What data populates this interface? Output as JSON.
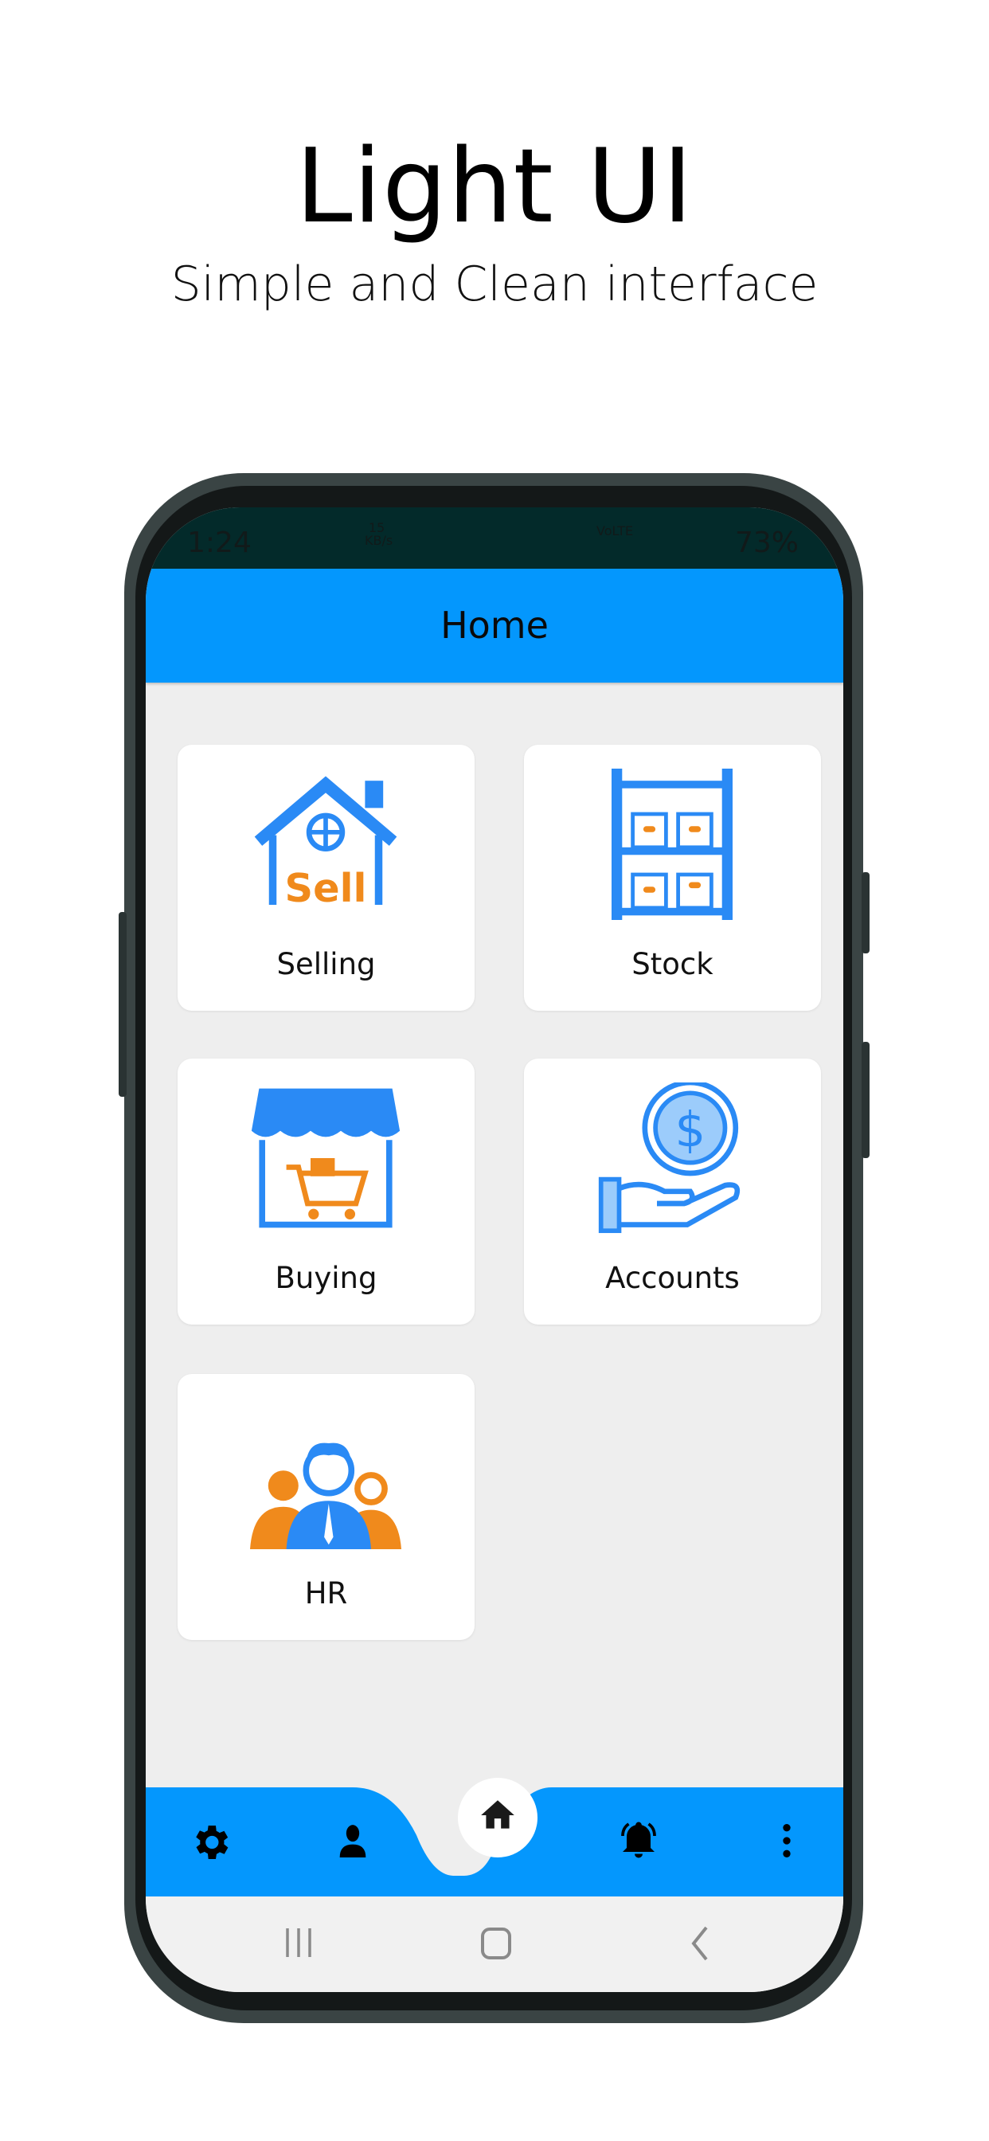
{
  "promo": {
    "title": "Light UI",
    "subtitle": "Simple and Clean interface"
  },
  "status_bar": {
    "time": "1:24",
    "net_speed": "15 KB/s",
    "battery": "73%",
    "network": "VoLTE"
  },
  "header": {
    "title": "Home"
  },
  "menu": [
    {
      "label": "Selling",
      "icon": "sell-house-icon",
      "badge_text": "Sell"
    },
    {
      "label": "Stock",
      "icon": "warehouse-shelf-icon"
    },
    {
      "label": "Buying",
      "icon": "shop-cart-icon"
    },
    {
      "label": "Accounts",
      "icon": "hand-dollar-coin-icon"
    },
    {
      "label": "HR",
      "icon": "people-group-icon"
    }
  ],
  "bottom_nav": {
    "items": [
      "settings-icon",
      "profile-icon",
      "home-icon",
      "notifications-icon",
      "more-icon"
    ],
    "active": "home-icon"
  },
  "colors": {
    "primary": "#0497fd",
    "icon_blue": "#2a8af5",
    "icon_orange": "#f08a1c",
    "background": "#eeeeee"
  }
}
